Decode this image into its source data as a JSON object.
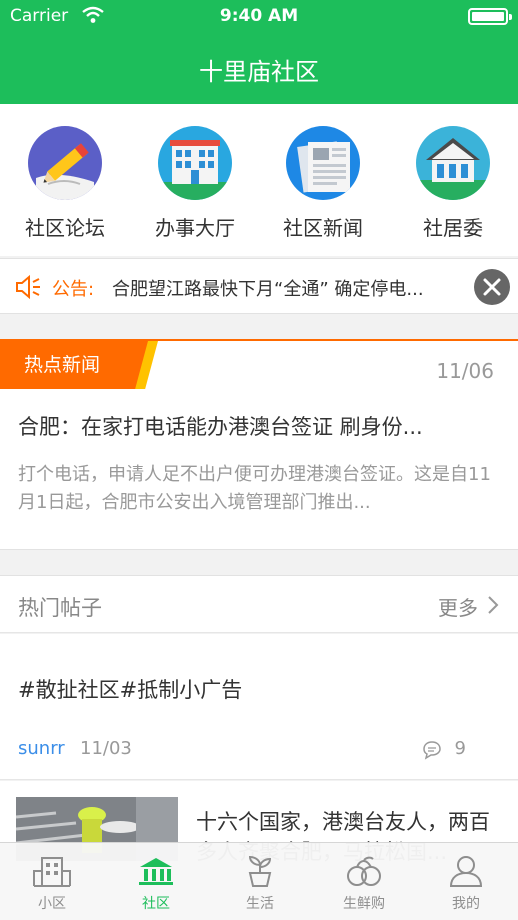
{
  "status_bar": {
    "carrier": "Carrier",
    "time": "9:40 AM"
  },
  "header": {
    "title": "十里庙社区"
  },
  "quick_links": [
    {
      "label": "社区论坛",
      "icon": "pencil-icon"
    },
    {
      "label": "办事大厅",
      "icon": "building-icon"
    },
    {
      "label": "社区新闻",
      "icon": "newspaper-icon"
    },
    {
      "label": "社居委",
      "icon": "house-icon"
    }
  ],
  "notice": {
    "tag": "公告:",
    "text": "合肥望江路最快下月“全通” 确定停电..."
  },
  "hot_news": {
    "badge": "热点新闻",
    "date": "11/06",
    "headline": "合肥：在家打电话能办港澳台签证 刷身份...",
    "summary": "打个电话，申请人足不出户便可办理港澳台签证。这是自11月1日起，合肥市公安出入境管理部门推出..."
  },
  "hot_posts": {
    "title": "热门帖子",
    "more_label": "更多",
    "items": [
      {
        "title": "#散扯社区#抵制小广告",
        "user": "sunrr",
        "date": "11/03",
        "comments": "9"
      },
      {
        "title": "十六个国家，港澳台友人，两百多人齐聚合肥，马拉松国..."
      }
    ]
  },
  "tabs": [
    {
      "label": "小区",
      "icon": "apartment-icon",
      "active": false
    },
    {
      "label": "社区",
      "icon": "civic-building-icon",
      "active": true
    },
    {
      "label": "生活",
      "icon": "plant-pot-icon",
      "active": false
    },
    {
      "label": "生鲜购",
      "icon": "fruit-icon",
      "active": false
    },
    {
      "label": "我的",
      "icon": "user-icon",
      "active": false
    }
  ],
  "colors": {
    "brand": "#1dbe5b",
    "accent": "#ff6a00",
    "link": "#3b8ee8"
  }
}
